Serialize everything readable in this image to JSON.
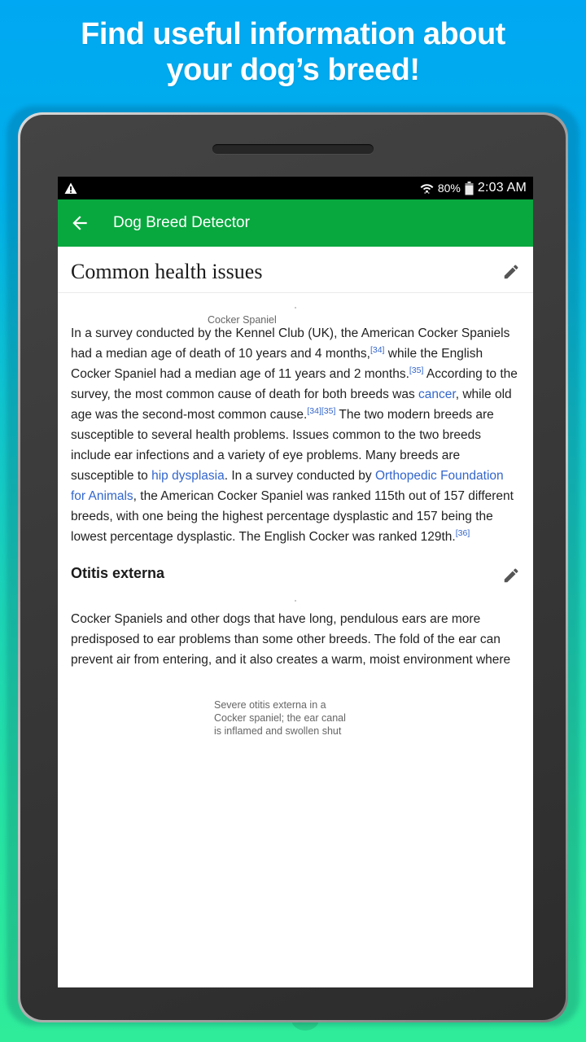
{
  "promo": {
    "headline_line1": "Find useful information about",
    "headline_line2": "your dog’s breed!"
  },
  "colors": {
    "promo_bg_top": "#00A8F3",
    "promo_bg_bottom": "#2FEC9A",
    "appbar_green": "#08A83E",
    "link_blue": "#3366CC",
    "statusbar_black": "#000000",
    "body_text": "#222222",
    "caption_gray": "#666666"
  },
  "statusbar": {
    "warning_icon": "warning-triangle-icon",
    "wifi_icon": "wifi-icon",
    "battery_percent": "80%",
    "battery_icon": "battery-icon",
    "clock": "2:03 AM"
  },
  "appbar": {
    "back_icon": "back-arrow-icon",
    "title": "Dog Breed Detector"
  },
  "sections": [
    {
      "title": "Common health issues",
      "edit_icon": "pencil-icon",
      "figure": {
        "image_name": "cocker-spaniel-photo",
        "caption": "Cocker Spaniel"
      },
      "paragraph_parts": [
        {
          "type": "text",
          "value": "In a survey conducted by the Kennel Club (UK), the American Cocker Spaniels had a median age of death of 10 years and 4 months,"
        },
        {
          "type": "ref",
          "value": "[34]"
        },
        {
          "type": "text",
          "value": " while the English Cocker Spaniel had a median age of 11 years and 2 months."
        },
        {
          "type": "ref",
          "value": "[35]"
        },
        {
          "type": "text",
          "value": " According to the survey, the most common cause of death for both breeds was "
        },
        {
          "type": "link",
          "value": "cancer"
        },
        {
          "type": "text",
          "value": ", while old age was the second-most common cause."
        },
        {
          "type": "ref",
          "value": "[34][35]"
        },
        {
          "type": "text",
          "value": " The two modern breeds are susceptible to several health problems. Issues common to the two breeds include ear infections and a variety of eye problems. Many breeds are susceptible to "
        },
        {
          "type": "link",
          "value": "hip dysplasia"
        },
        {
          "type": "text",
          "value": ". In a survey conducted by "
        },
        {
          "type": "link",
          "value": "Orthopedic Foundation for Animals"
        },
        {
          "type": "text",
          "value": ", the American Cocker Spaniel was ranked 115th out of 157 different breeds, with one being the highest percentage dysplastic and 157 being the lowest percentage dysplastic. The English Cocker was ranked 129th."
        },
        {
          "type": "ref",
          "value": "[36]"
        }
      ]
    },
    {
      "title": "Otitis externa",
      "edit_icon": "pencil-icon",
      "figure": {
        "image_name": "severe-otitis-externa-photo",
        "caption_line1": "Severe otitis externa in a",
        "caption_line2": "Cocker spaniel; the ear canal",
        "caption_line3": "is inflamed and swollen shut"
      },
      "paragraph": "Cocker Spaniels and other dogs that have long, pendulous ears are more predisposed to ear problems than some other breeds. The fold of the ear can prevent air from entering, and it also creates a warm, moist environment where"
    }
  ]
}
